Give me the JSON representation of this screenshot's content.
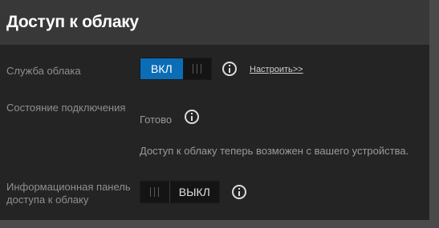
{
  "header": {
    "title": "Доступ к облаку"
  },
  "cloud_service": {
    "label": "Служба облака",
    "toggle_label": "ВКЛ",
    "toggle_state": "on",
    "configure_link": "Настроить>>"
  },
  "connection_status": {
    "label": "Состояние подключения",
    "value": "Готово",
    "message": "Доступ к облаку теперь возможен с вашего устройства."
  },
  "dashboard_access": {
    "label": "Информационная панель доступа к облаку",
    "toggle_label": "ВЫКЛ",
    "toggle_state": "off"
  },
  "colors": {
    "accent": "#0b6db6",
    "panel": "#242424",
    "header": "#383838"
  },
  "icons": [
    "info-icon",
    "toggle-grip-icon"
  ]
}
